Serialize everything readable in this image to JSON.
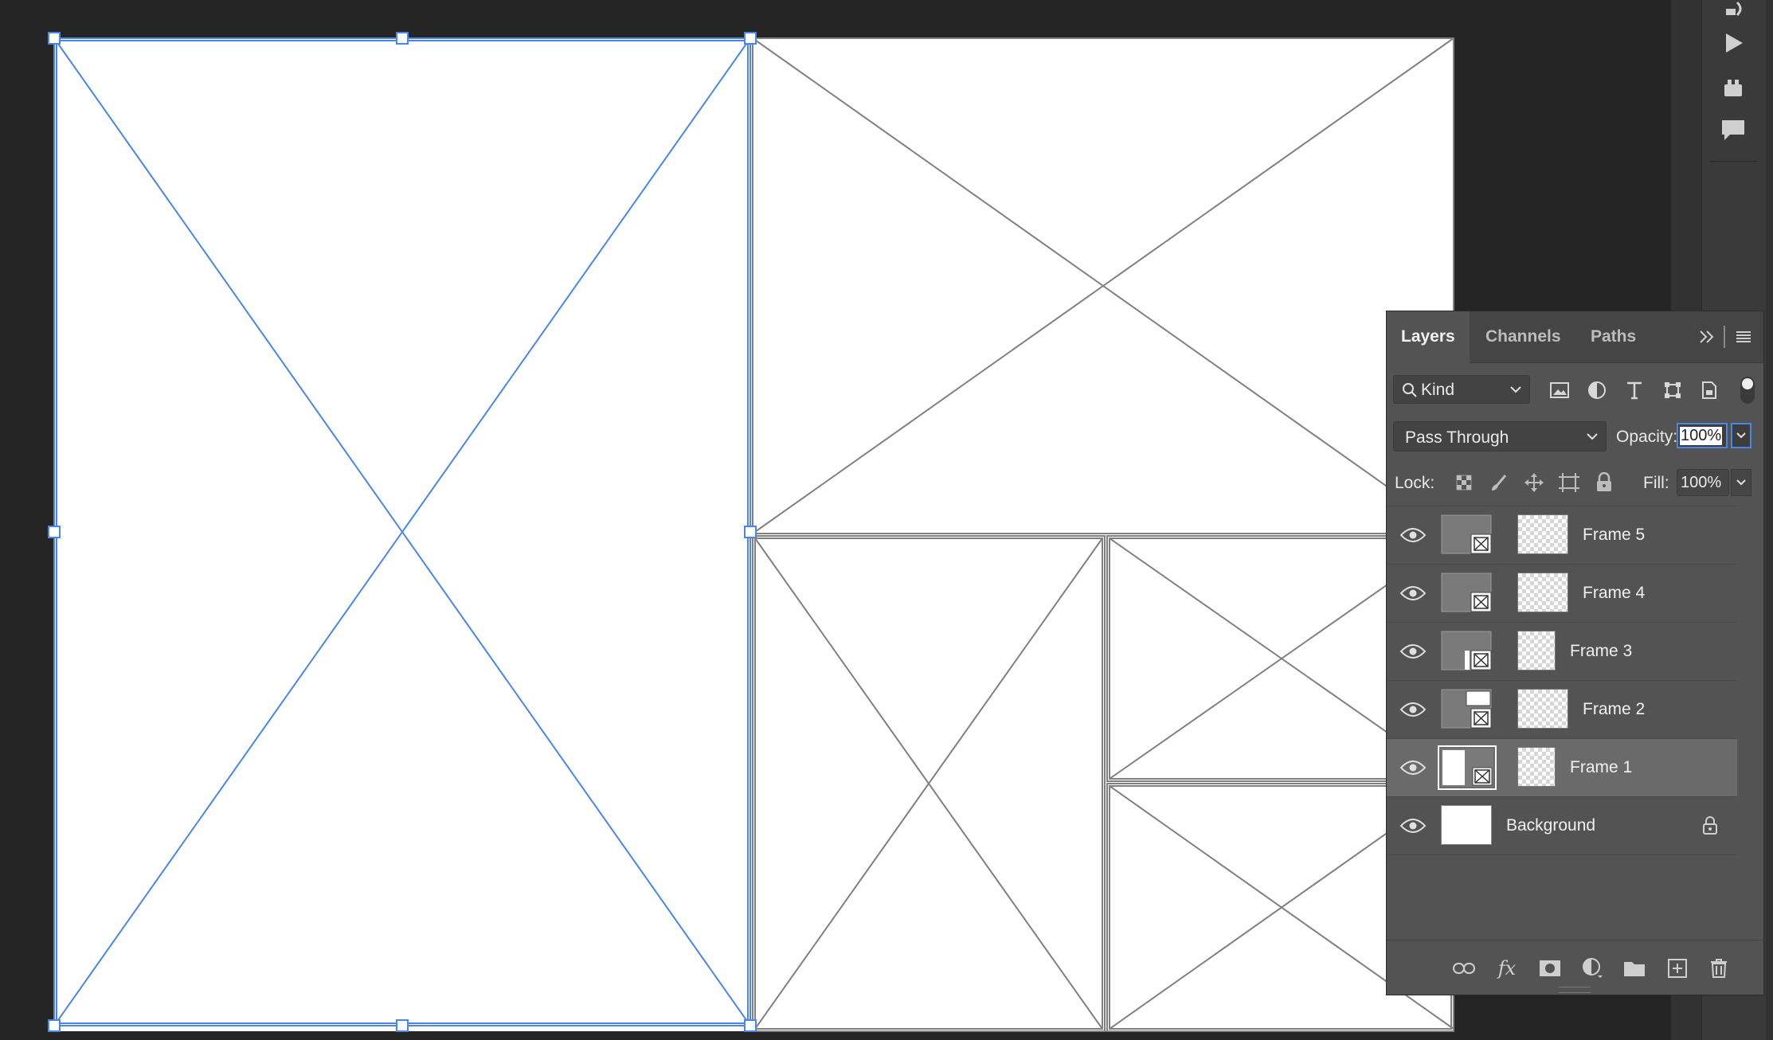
{
  "layers_panel": {
    "tabs": [
      {
        "label": "Layers",
        "active": true
      },
      {
        "label": "Channels",
        "active": false
      },
      {
        "label": "Paths",
        "active": false
      }
    ],
    "filter": {
      "label": "Kind"
    },
    "blend_mode": "Pass Through",
    "opacity": {
      "label": "Opacity:",
      "value": "100%"
    },
    "lock": {
      "label": "Lock:"
    },
    "fill": {
      "label": "Fill:",
      "value": "100%"
    },
    "layers": [
      {
        "name": "Frame 5",
        "visible": true,
        "selected": false
      },
      {
        "name": "Frame 4",
        "visible": true,
        "selected": false
      },
      {
        "name": "Frame 3",
        "visible": true,
        "selected": false
      },
      {
        "name": "Frame 2",
        "visible": true,
        "selected": false
      },
      {
        "name": "Frame 1",
        "visible": true,
        "selected": true
      },
      {
        "name": "Background",
        "visible": true,
        "selected": false,
        "locked": true
      }
    ]
  },
  "colors": {
    "selection": "#4a86e8",
    "frame_line": "#808080",
    "canvas": "#ffffff",
    "workspace": "#252525",
    "panel": "#535353"
  }
}
